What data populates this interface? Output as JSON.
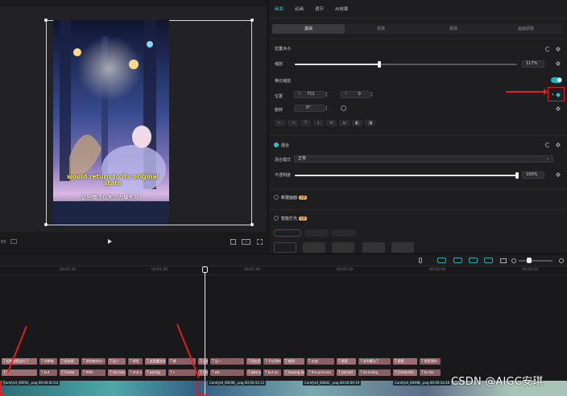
{
  "player": {
    "time_left": "03",
    "subtitle_en": "would return to its original state",
    "subtitle_zh": "这些魔法在失去力量失效。"
  },
  "panel": {
    "tabs": [
      "画面",
      "动画",
      "调节",
      "AI效果"
    ],
    "subtabs": [
      "基础",
      "抠像",
      "蒙版",
      "画面调整"
    ],
    "section_position": "位置大小",
    "scale_label": "缩放",
    "scale_value": "117%",
    "uniform_label": "等比缩放",
    "position_label": "位置",
    "pos_x_label": "X",
    "pos_x_value": "711",
    "pos_y_label": "Y",
    "pos_y_value": "0",
    "rotate_label": "旋转",
    "rotate_value": "0°",
    "align_buttons": [
      "⊢",
      "⊣",
      "⊤",
      "⊥",
      "⊓",
      "⊔",
      "◧",
      "◨"
    ],
    "blend_section": "混合",
    "blend_mode_label": "混合模式",
    "blend_mode_value": "正常",
    "opacity_label": "不透明度",
    "opacity_value": "100%",
    "opacity_level": 1.0,
    "scale_level": 0.38,
    "section_new": "新建画面",
    "section_ai": "智能打光",
    "vip_badge": "VIP"
  },
  "timeline": {
    "ruler": [
      "00:01:20",
      "00:01:30",
      "00:01:40",
      "00:01:50",
      "00:02:00",
      "00:02:10"
    ],
    "text_clips_row1": [
      "T 但其就是这么了",
      "T 如果能",
      "T 但在那",
      "T 那些被关在一",
      "T 当一",
      "T 那是",
      "T 这是魔法在失败",
      "T 都",
      "T 让被创造的王子",
      "T 当一",
      "T 但它仍",
      "T 不过我的看法是",
      "T 感到",
      "T 在迷",
      "T 那是",
      "T 直到魔法了",
      "T 那是",
      "T 那是我的"
    ],
    "text_clips_row2": [
      "T Ja",
      "T but",
      "T Cinder",
      "T With",
      "T she became",
      "T and a",
      "T asking",
      "T s",
      "T Cinderella",
      "T wh",
      "T who w",
      "T but as",
      "T leaving behi",
      "T the princess",
      "T carried",
      "T Including",
      "T Cinderella",
      "T to the"
    ],
    "video_clips": [
      {
        "name": "ComfyUI_00591_.png",
        "time": "00:00:02:03"
      },
      {
        "name": "ComfyUI_00596_.png",
        "time": "00:00:10:12"
      },
      {
        "name": "ComfyUI_00602_.png",
        "time": "00:00:09:19"
      },
      {
        "name": "ComfyUI_00498_.png",
        "time": "00:00:14:20"
      }
    ]
  },
  "watermark": "CSDN @AIGC安琪"
}
